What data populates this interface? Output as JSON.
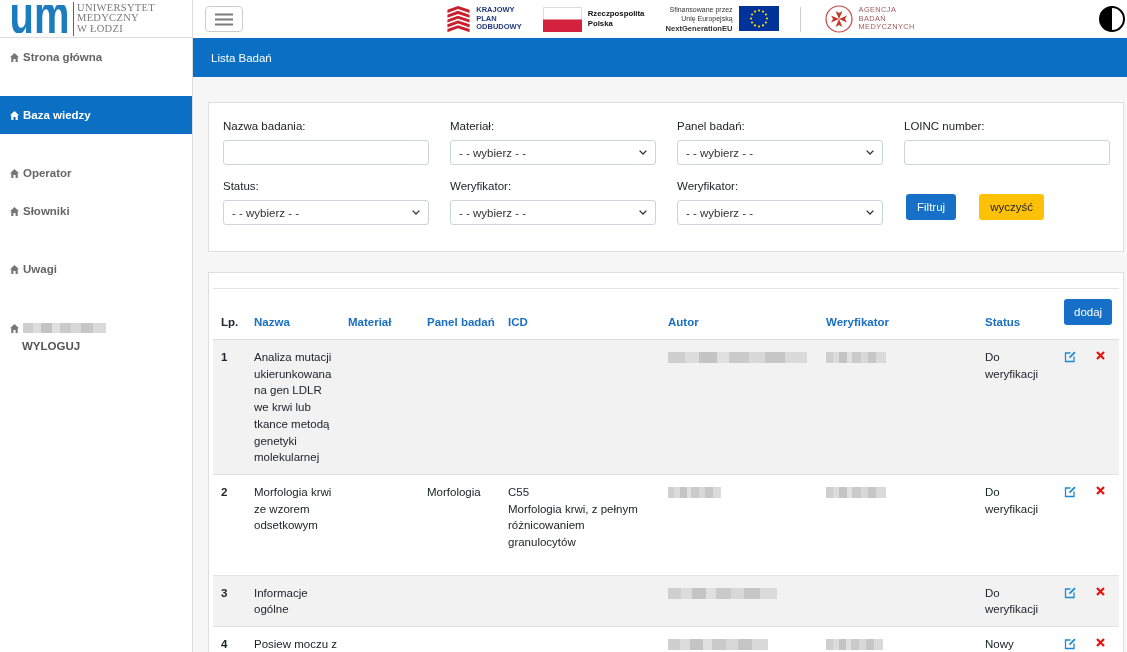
{
  "header": {
    "logo": {
      "mark": "um",
      "name": "UNIWERSYTET\nMEDYCZNY\nW ŁODZI"
    },
    "partners": [
      {
        "kind": "kpo",
        "caption": "KRAJOWY\nPLAN\nODBUDOWY"
      },
      {
        "kind": "pl_flag",
        "caption": "Rzeczpospolita\nPolska"
      },
      {
        "kind": "eu",
        "caption": "Sfinansowane przez\nUnię Europejską\n**NextGenerationEU**"
      },
      {
        "kind": "abm",
        "caption": "AGENCJA\nBADAŃ\nMEDYCZNYCH"
      }
    ]
  },
  "sidebar": {
    "groups": [
      {
        "items": [
          {
            "kind": "link",
            "label": "Strona główna",
            "selected": false
          }
        ]
      },
      {
        "items": [
          {
            "kind": "link",
            "label": "Baza wiedzy",
            "selected": true
          }
        ]
      },
      {
        "items": [
          {
            "kind": "link",
            "label": "Operator",
            "selected": false
          },
          {
            "kind": "link",
            "label": "Słowniki",
            "selected": false
          }
        ]
      },
      {
        "items": [
          {
            "kind": "link",
            "label": "Uwagi",
            "selected": false
          }
        ]
      },
      {
        "items": [
          {
            "kind": "user",
            "name_redacted": true,
            "logout": "WYLOGUJ",
            "selected": false
          }
        ]
      }
    ]
  },
  "page_title": "Lista Badań",
  "filters": {
    "fields": [
      {
        "kind": "text",
        "label": "Nazwa badania:"
      },
      {
        "kind": "select",
        "label": "Materiał:",
        "value": "- - wybierz - -"
      },
      {
        "kind": "select",
        "label": "Panel badań:",
        "value": "- - wybierz - -"
      },
      {
        "kind": "text",
        "label": "LOINC number:"
      },
      {
        "kind": "select",
        "label": "Status:",
        "value": "- - wybierz - -"
      },
      {
        "kind": "select",
        "label": "Weryfikator:",
        "value": "- - wybierz - -"
      },
      {
        "kind": "select",
        "label": "Weryfikator:",
        "value": "- - wybierz - -"
      }
    ],
    "buttons": [
      {
        "kind": "primary",
        "label": "Filtruj"
      },
      {
        "kind": "warning",
        "label": "wyczyść"
      }
    ]
  },
  "table": {
    "columns": [
      {
        "label": "Lp.",
        "kind": "plain"
      },
      {
        "label": "Nazwa",
        "kind": "link"
      },
      {
        "label": "Materiał",
        "kind": "link"
      },
      {
        "label": "Panel badań",
        "kind": "link"
      },
      {
        "label": "ICD",
        "kind": "link"
      },
      {
        "label": "Autor",
        "kind": "link"
      },
      {
        "label": "Weryfikator",
        "kind": "link"
      },
      {
        "label": "Status",
        "kind": "link"
      }
    ],
    "add_button": "dodaj",
    "rows": [
      {
        "lp": "1",
        "nazwa": "Analiza mutacji ukierunkowana na gen LDLR we krwi lub tkance metodą genetyki molekularnej",
        "autor_redacted": true,
        "weryfikator_redacted": true,
        "status": "Do weryfikacji"
      },
      {
        "lp": "2",
        "nazwa": "Morfologia krwi ze wzorem odsetkowym",
        "panel": "Morfologia",
        "icd": {
          "code": "C55",
          "description": "Morfologia krwi, z pełnym różnicowaniem granulocytów"
        },
        "autor_redacted": true,
        "weryfikator_redacted": true,
        "status": "Do weryfikacji"
      },
      {
        "lp": "3",
        "nazwa": "Informacje ogólne",
        "autor_redacted": true,
        "weryfikator_redacted": false,
        "status": "Do weryfikacji"
      },
      {
        "lp": "4",
        "nazwa": "Posiew moczu z",
        "autor_redacted": true,
        "weryfikator_redacted": true,
        "status": "Nowy"
      }
    ]
  }
}
